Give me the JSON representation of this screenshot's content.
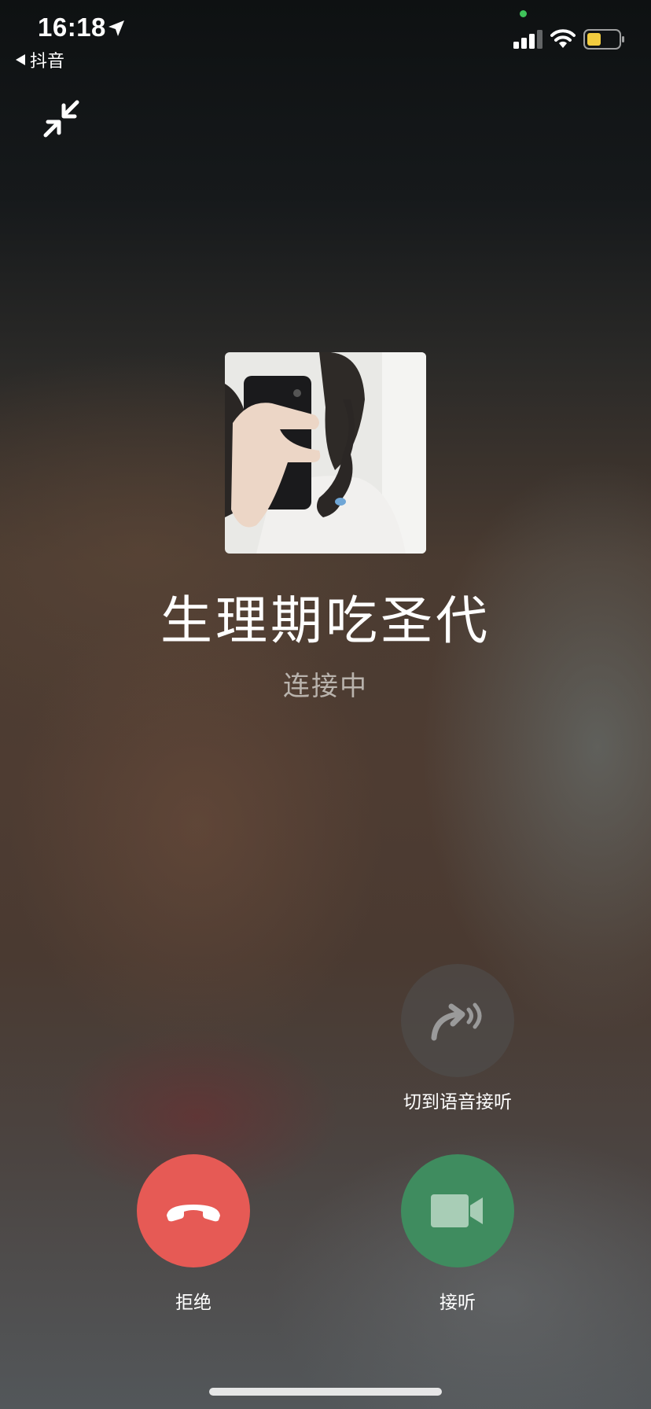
{
  "status_bar": {
    "time": "16:18",
    "back_app": "抖音"
  },
  "caller": {
    "name": "生理期吃圣代",
    "status": "连接中"
  },
  "actions": {
    "switch_voice_label": "切到语音接听",
    "decline_label": "拒绝",
    "accept_label": "接听"
  },
  "colors": {
    "decline": "#e65a55",
    "accept": "#3f8c5f",
    "voice_button": "#505050"
  },
  "icons": {
    "location": "location-arrow-icon",
    "minimize": "minimize-arrows-icon",
    "switch_voice": "voice-redirect-icon",
    "decline": "hang-up-phone-icon",
    "accept": "video-camera-icon"
  }
}
